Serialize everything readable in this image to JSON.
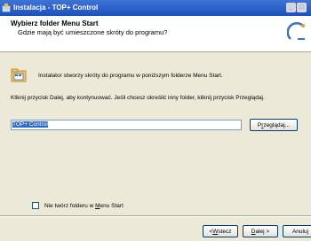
{
  "window": {
    "title": "Instalacja - TOP+ Control"
  },
  "header": {
    "heading": "Wybierz folder Menu Start",
    "subheading": "Gdzie mają być umieszczone skróty do programu?"
  },
  "body": {
    "intro": "Instalator stworzy skróty do programu w poniższym folderze Menu Start.",
    "instruction": "Kliknij przycisk Dalej, aby kontynuować. Jeśli chcesz określić inny folder, kliknij przycisk Przeglądaj.",
    "folder_value": "TOP+ Control",
    "browse_label_pre": "P",
    "browse_label_u": "r",
    "browse_label_post": "zeglądaj...",
    "checkbox_pre": "Nie twórz folderu w ",
    "checkbox_u": "M",
    "checkbox_post": "enu Start"
  },
  "footer": {
    "back_pre": "< ",
    "back_u": "W",
    "back_post": "stecz",
    "next_u": "D",
    "next_post": "alej >",
    "cancel": "Anuluj"
  }
}
